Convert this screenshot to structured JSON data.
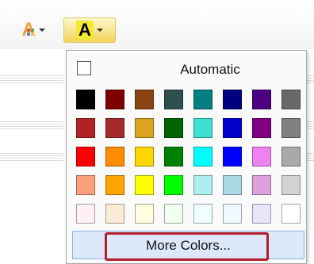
{
  "toolbar": {
    "font_color_button": {
      "glyph": "A",
      "icon": "font-color-icon"
    },
    "highlight_button": {
      "glyph": "A",
      "icon": "text-highlight-color-icon",
      "highlight_color": "#f3e833"
    }
  },
  "color_menu": {
    "automatic_label": "Automatic",
    "more_colors_label": "More Colors...",
    "rows": [
      [
        "#000000",
        "#7f0000",
        "#8b4513",
        "#2f4f4f",
        "#008080",
        "#000080",
        "#4b0082",
        "#696969"
      ],
      [
        "#b22222",
        "#a52a2a",
        "#daa520",
        "#006400",
        "#40e0d0",
        "#0000cd",
        "#800080",
        "#808080"
      ],
      [
        "#ff0000",
        "#ff8c00",
        "#ffd700",
        "#008000",
        "#00ffff",
        "#0000ff",
        "#ee82ee",
        "#a9a9a9"
      ],
      [
        "#ffa07a",
        "#ffa500",
        "#ffff00",
        "#00ff00",
        "#afeeee",
        "#add8e6",
        "#dda0dd",
        "#d3d3d3"
      ],
      [
        "#fff0f5",
        "#faebd7",
        "#ffffe0",
        "#f0fff0",
        "#f0ffff",
        "#f0f8ff",
        "#e6e6fa",
        "#ffffff"
      ]
    ]
  }
}
